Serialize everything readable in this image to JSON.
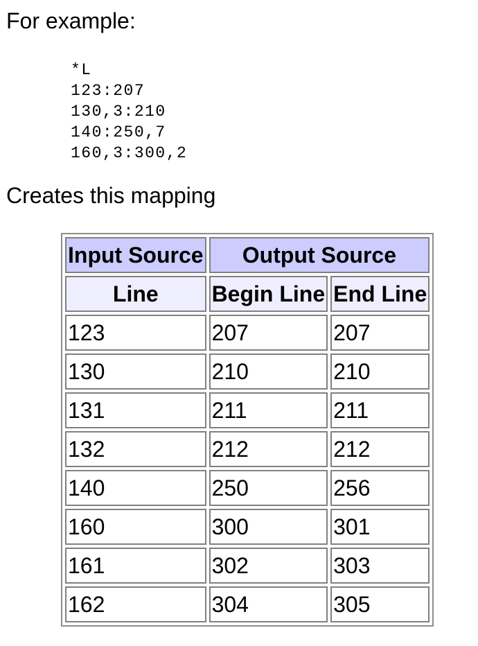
{
  "intro_text": "For example:",
  "code_lines": [
    "*L",
    "123:207",
    "130,3:210",
    "140:250,7",
    "160,3:300,2"
  ],
  "caption_text": "Creates this mapping",
  "table": {
    "header_input": "Input Source",
    "header_output": "Output Source",
    "sub_line": "Line",
    "sub_begin": "Begin Line",
    "sub_end": "End Line",
    "rows": [
      [
        "123",
        "207",
        "207"
      ],
      [
        "130",
        "210",
        "210"
      ],
      [
        "131",
        "211",
        "211"
      ],
      [
        "132",
        "212",
        "212"
      ],
      [
        "140",
        "250",
        "256"
      ],
      [
        "160",
        "300",
        "301"
      ],
      [
        "161",
        "302",
        "303"
      ],
      [
        "162",
        "304",
        "305"
      ]
    ],
    "header_colors": {
      "top": "#ccccff",
      "sub": "#eeeeff"
    }
  }
}
